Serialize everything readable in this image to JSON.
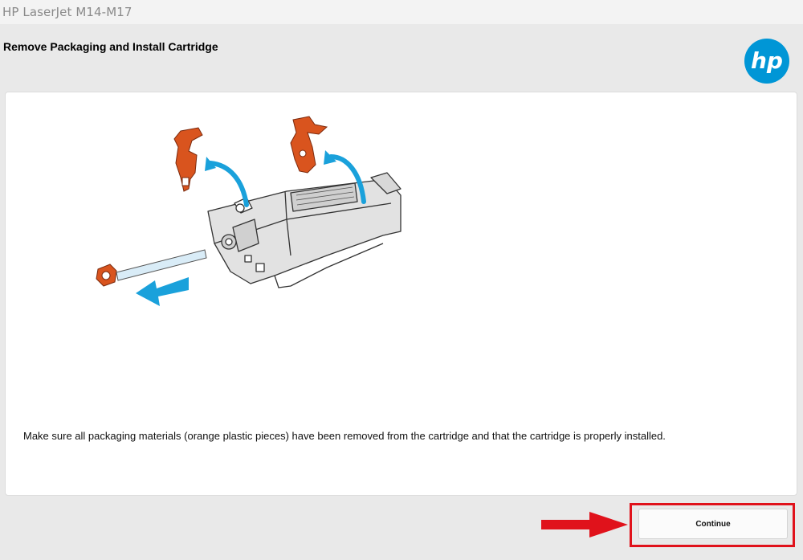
{
  "window": {
    "title": "HP LaserJet M14-M17"
  },
  "header": {
    "title": "Remove Packaging and Install Cartridge",
    "logo_text": "hp",
    "logo_icon": "hp-logo-icon"
  },
  "main": {
    "illustration": "cartridge-packaging-removal-illustration",
    "instruction": "Make sure all packaging materials (orange plastic pieces) have been removed from the cartridge and that the cartridge is properly installed."
  },
  "footer": {
    "continue_label": "Continue"
  },
  "colors": {
    "accent": "#0096d6",
    "packaging_orange": "#d9541e",
    "annotation_red": "#e0121b",
    "panel_bg": "#ffffff",
    "window_bg": "#e9e9e9"
  }
}
